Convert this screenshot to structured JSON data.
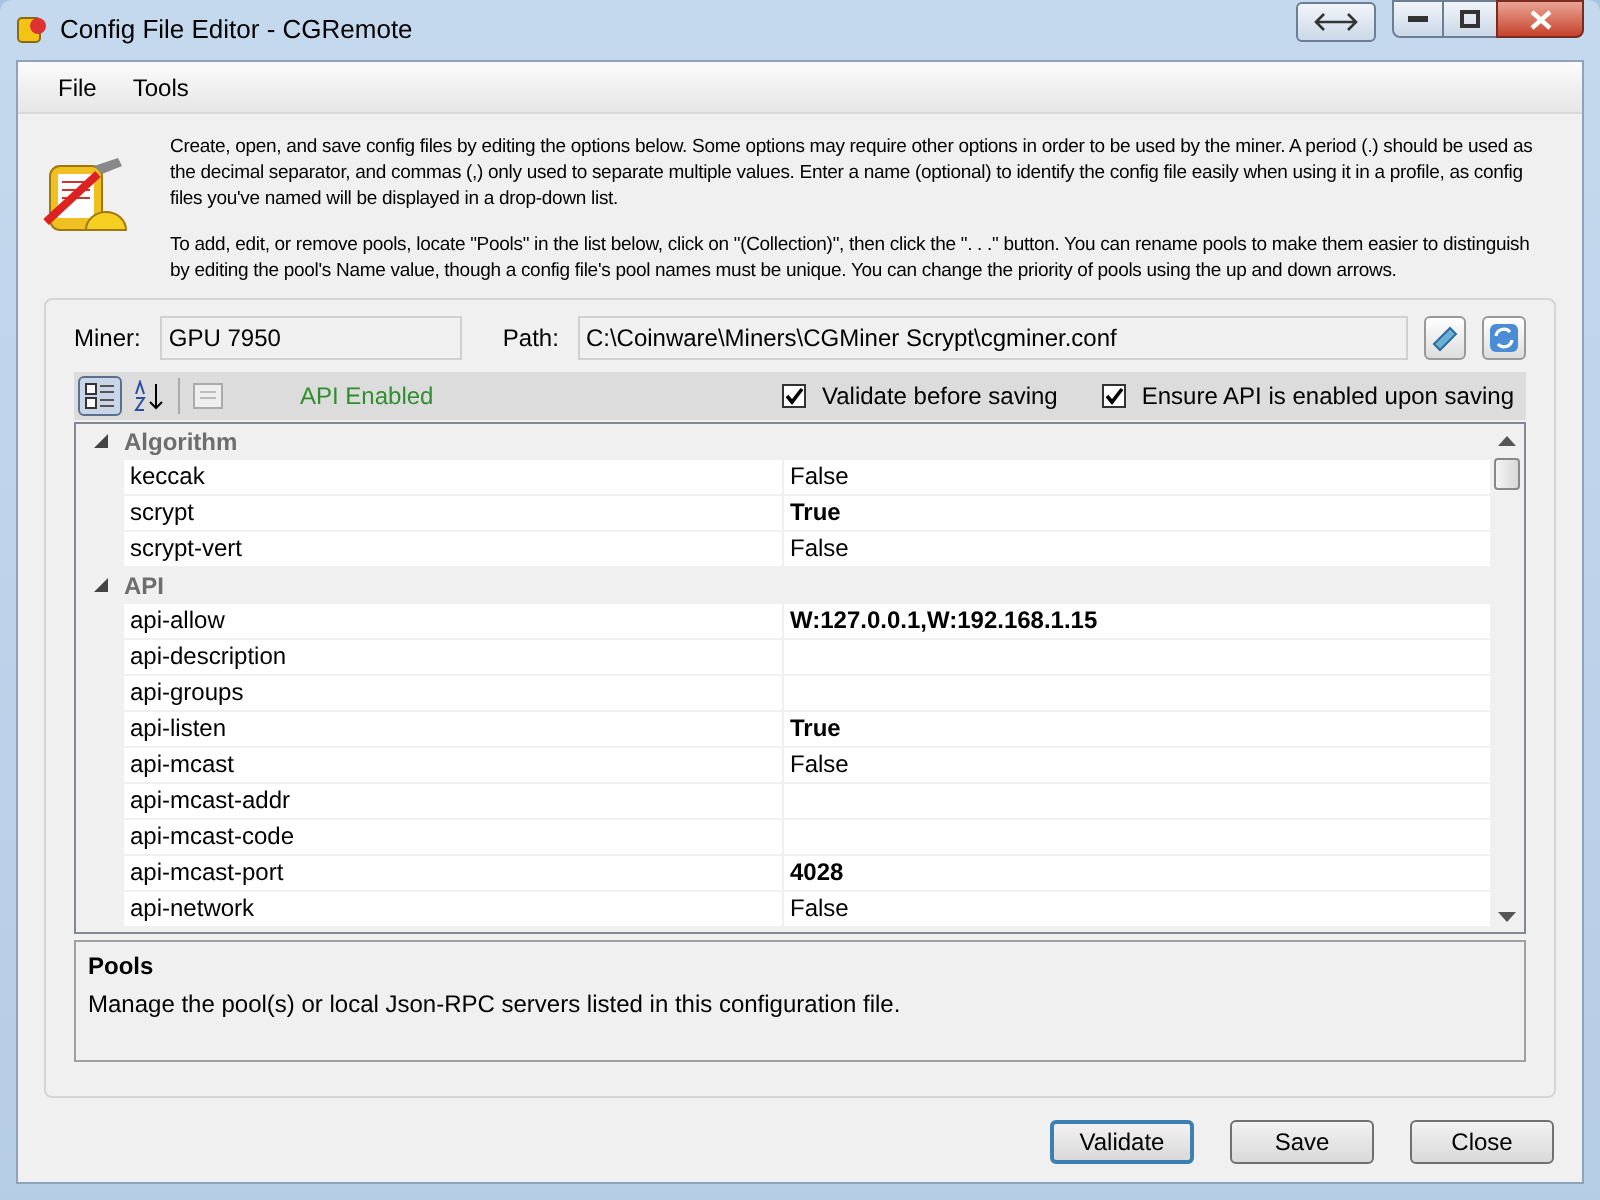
{
  "window": {
    "title": "Config File Editor - CGRemote"
  },
  "menu": [
    {
      "label": "File"
    },
    {
      "label": "Tools"
    }
  ],
  "intro": [
    "Create, open, and save config files by editing the options below. Some options may require other options in order to be used by the miner. A period (.) should be used as the decimal separator, and commas (,) only used to separate multiple values. Enter a name (optional) to identify the config file easily when using it in a profile, as config files you've named will be displayed in a drop-down list.",
    "To add, edit, or remove pools, locate \"Pools\" in the list below, click on \"(Collection)\", then click the \". . .\" button. You can rename pools to make them easier to distinguish by editing the pool's Name value, though a config file's pool names must be unique. You can change the priority of pools using the up and down arrows."
  ],
  "miner": {
    "label": "Miner:",
    "value": "GPU 7950"
  },
  "path": {
    "label": "Path:",
    "value": "C:\\Coinware\\Miners\\CGMiner Scrypt\\cgminer.conf"
  },
  "toolbar": {
    "categorized_selected": true,
    "api_status": "API Enabled",
    "checkboxes": [
      {
        "label": "Validate before saving",
        "checked": true
      },
      {
        "label": "Ensure API is enabled upon saving",
        "checked": true
      }
    ]
  },
  "grid": [
    {
      "category": "Algorithm",
      "expanded": true,
      "children": [
        {
          "name": "keccak",
          "value": "False",
          "modified": false
        },
        {
          "name": "scrypt",
          "value": "True",
          "modified": true
        },
        {
          "name": "scrypt-vert",
          "value": "False",
          "modified": false
        }
      ]
    },
    {
      "category": "API",
      "expanded": true,
      "children": [
        {
          "name": "api-allow",
          "value": "W:127.0.0.1,W:192.168.1.15",
          "modified": true
        },
        {
          "name": "api-description",
          "modified": false
        },
        {
          "name": "api-groups",
          "modified": false
        },
        {
          "name": "api-listen",
          "value": "True",
          "modified": true
        },
        {
          "name": "api-mcast",
          "value": "False",
          "modified": false
        },
        {
          "name": "api-mcast-addr",
          "modified": false
        },
        {
          "name": "api-mcast-code",
          "modified": false
        },
        {
          "name": "api-mcast-port",
          "value": "4028",
          "modified": true
        },
        {
          "name": "api-network",
          "value": "False",
          "modified": false
        }
      ]
    }
  ],
  "description": {
    "title": "Pools",
    "text": "Manage the pool(s) or local Json-RPC servers listed in this configuration file."
  },
  "buttons": [
    {
      "label": "Validate",
      "default": true
    },
    {
      "label": "Save",
      "default": false
    },
    {
      "label": "Close",
      "default": false
    }
  ]
}
